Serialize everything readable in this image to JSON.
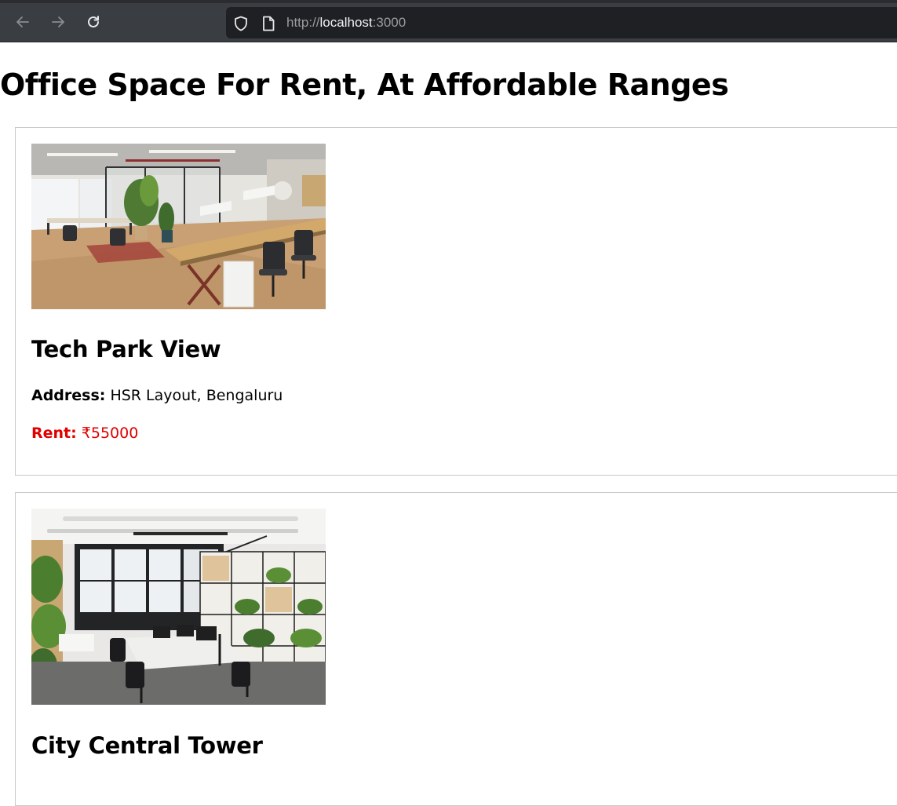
{
  "browser": {
    "url_scheme": "http://",
    "url_host": "localhost",
    "url_port": ":3000"
  },
  "page": {
    "title": "Office Space For Rent, At Affordable Ranges"
  },
  "listings": [
    {
      "name": "Tech Park View",
      "address_label": "Address:",
      "address": "HSR Layout, Bengaluru",
      "rent_label": "Rent:",
      "rent": "₹55000"
    },
    {
      "name": "City Central Tower"
    }
  ],
  "colors": {
    "rent_text": "#e00000",
    "card_border": "#c9c9c9",
    "chrome_bg": "#3a3d42"
  }
}
